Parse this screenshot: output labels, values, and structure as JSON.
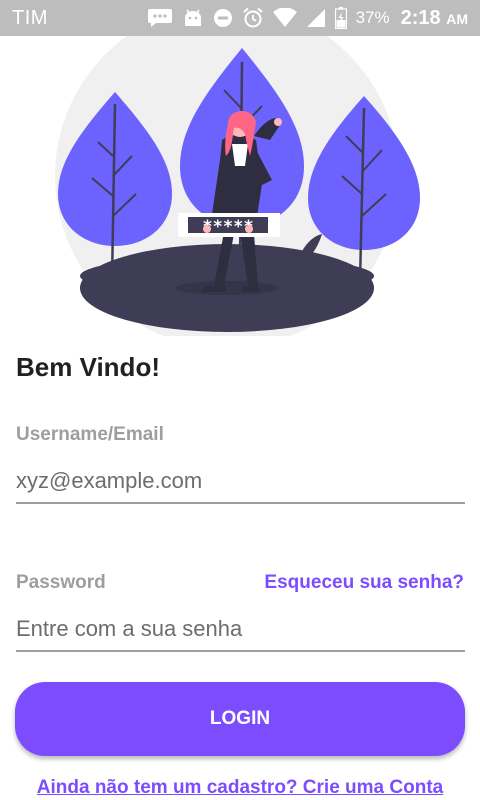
{
  "status_bar": {
    "carrier": "TIM",
    "battery": "37%",
    "time": "2:18",
    "ampm": "AM",
    "icons": [
      "message-icon",
      "android-icon",
      "do-not-disturb-icon",
      "alarm-icon",
      "wifi-icon",
      "signal-icon",
      "battery-icon"
    ]
  },
  "hero": {
    "illustration": "woman-with-password-illustration",
    "password_mask": "*****",
    "colors": {
      "tree": "#6c63ff",
      "ground": "#3f3d56",
      "hair": "#ff6584",
      "backdrop": "#f0f0f0"
    }
  },
  "login": {
    "welcome": "Bem Vindo!",
    "username_label": "Username/Email",
    "username_placeholder": "xyz@example.com",
    "password_label": "Password",
    "password_placeholder": "Entre com a sua senha",
    "forgot": "Esqueceu sua senha?",
    "button": "LOGIN",
    "signup": "Ainda não tem um cadastro? Crie uma Conta"
  },
  "colors": {
    "accent": "#7c4dff",
    "label": "#9e9e9e",
    "status_bar": "#bdbdbd"
  }
}
